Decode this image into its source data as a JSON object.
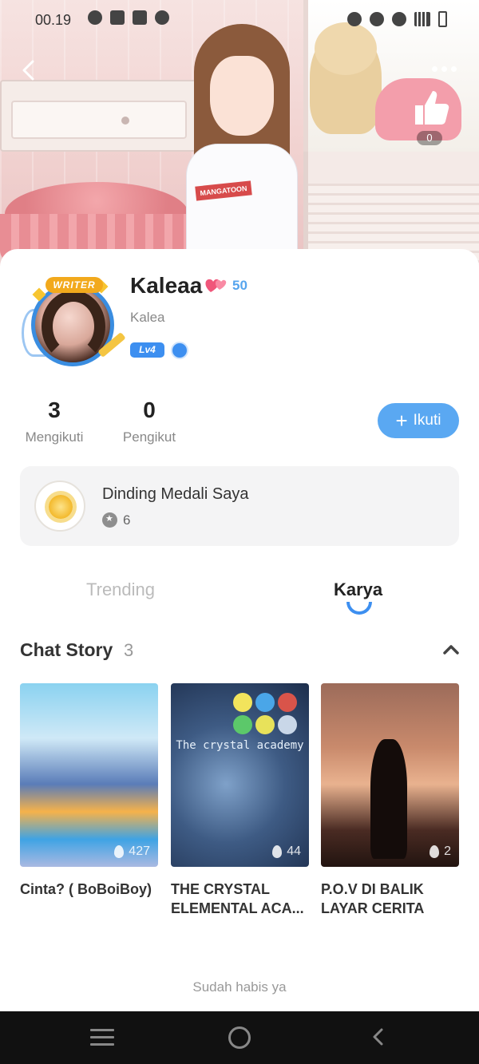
{
  "status_bar": {
    "time": "00.19"
  },
  "header": {
    "like_count": "0"
  },
  "profile": {
    "username": "Kaleaa",
    "heart_count": "50",
    "handle": "Kalea",
    "writer_badge": "WRITER",
    "level_badge": "Lv4",
    "cover_shirt_text": "MANGATOON"
  },
  "stats": {
    "following_count": "3",
    "following_label": "Mengikuti",
    "followers_count": "0",
    "followers_label": "Pengikut"
  },
  "follow_button": {
    "label": "Ikuti"
  },
  "medal_wall": {
    "title": "Dinding Medali Saya",
    "count": "6"
  },
  "tabs": [
    {
      "label": "Trending",
      "active": false
    },
    {
      "label": "Karya",
      "active": true
    }
  ],
  "section": {
    "title": "Chat Story",
    "count": "3"
  },
  "stories": [
    {
      "title": "Cinta? ( BoBoiBoy)",
      "views": "427"
    },
    {
      "title": "THE CRYSTAL ELEMENTAL ACA...",
      "views": "44",
      "cover_text": "The crystal academy"
    },
    {
      "title": "P.O.V DI BALIK LAYAR CERITA",
      "views": "2"
    }
  ],
  "footer": {
    "end_text": "Sudah habis ya"
  },
  "colors": {
    "accent": "#3d8ff0",
    "follow_button": "#5aa8f2",
    "heart_count": "#56a5ee"
  }
}
